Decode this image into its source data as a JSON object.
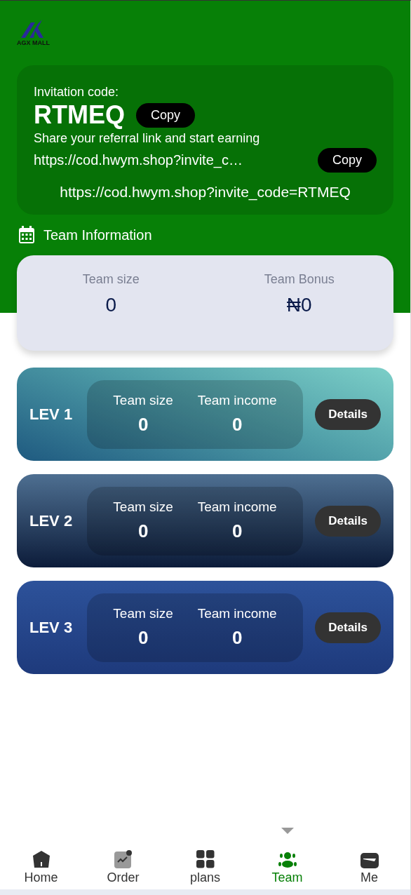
{
  "logo": {
    "text": "AGX MALL"
  },
  "invite": {
    "label": "Invitation code:",
    "code": "RTMEQ",
    "copy_code": "Copy",
    "share_text": "Share your referral link and start earning",
    "link_short": "https://cod.hwym.shop?invite_c…",
    "copy_link": "Copy",
    "link_full": "https://cod.hwym.shop?invite_code=RTMEQ"
  },
  "team_info": {
    "title": "Team Information",
    "stats": [
      {
        "label": "Team size",
        "value": "0"
      },
      {
        "label": "Team Bonus",
        "value": "₦0"
      }
    ]
  },
  "levels": [
    {
      "name": "LEV 1",
      "size_label": "Team size",
      "size": "0",
      "income_label": "Team income",
      "income": "0",
      "button": "Details"
    },
    {
      "name": "LEV 2",
      "size_label": "Team size",
      "size": "0",
      "income_label": "Team income",
      "income": "0",
      "button": "Details"
    },
    {
      "name": "LEV 3",
      "size_label": "Team size",
      "size": "0",
      "income_label": "Team income",
      "income": "0",
      "button": "Details"
    }
  ],
  "nav": [
    {
      "label": "Home",
      "kind": "home",
      "selected": false
    },
    {
      "label": "Order",
      "kind": "order",
      "selected": false
    },
    {
      "label": "plans",
      "kind": "plans",
      "selected": false
    },
    {
      "label": "Team",
      "kind": "team",
      "selected": true
    },
    {
      "label": "Me",
      "kind": "me",
      "selected": false
    }
  ]
}
